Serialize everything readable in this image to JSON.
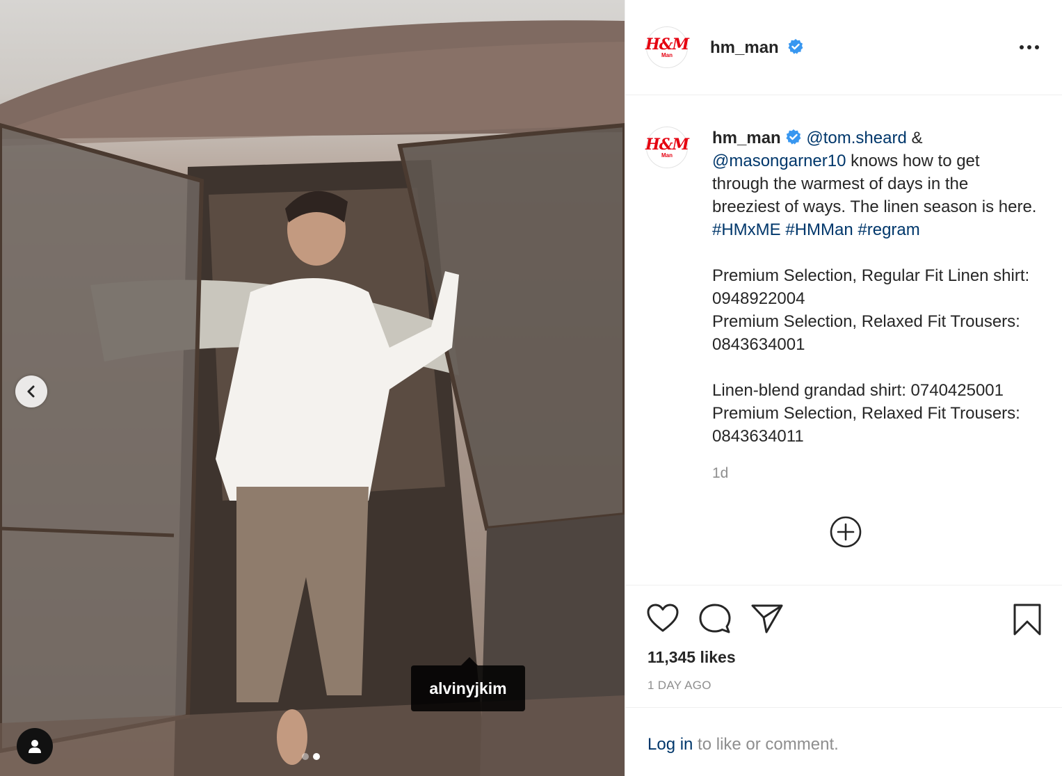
{
  "post": {
    "tagged_user": "alvinyjkim",
    "carousel_count": 2,
    "carousel_active": 2
  },
  "header": {
    "avatar_logo": "H&M",
    "avatar_sub": "Man",
    "username": "hm_man"
  },
  "caption": {
    "username": "hm_man",
    "mention1": "@tom.sheard",
    "amp": " & ",
    "mention2": "@masongarner10",
    "text1": " knows how to get through the warmest of days in the breeziest of ways. The linen season is here. ",
    "hashtag1": "#HMxME",
    "hashtag2": "#HMMan",
    "hashtag3": "#regram",
    "product1": "Premium Selection, Regular Fit Linen shirt: 0948922004",
    "product2": "Premium Selection, Relaxed Fit Trousers: 0843634001",
    "product3": "Linen-blend grandad shirt: 0740425001",
    "product4": "Premium Selection, Relaxed Fit Trousers: 0843634011",
    "time": "1d"
  },
  "stats": {
    "likes": "11,345 likes",
    "date": "1 DAY AGO"
  },
  "footer": {
    "login_link": "Log in",
    "login_rest": " to like or comment."
  },
  "colors": {
    "brand": "#e50010",
    "link": "#00376b",
    "verified": "#3897f0",
    "muted": "#8e8e8e"
  },
  "icons": [
    "chevron-left-icon",
    "user-tag-icon",
    "verified-icon",
    "more-icon",
    "plus-circle-icon",
    "heart-icon",
    "comment-icon",
    "share-icon",
    "bookmark-icon"
  ]
}
